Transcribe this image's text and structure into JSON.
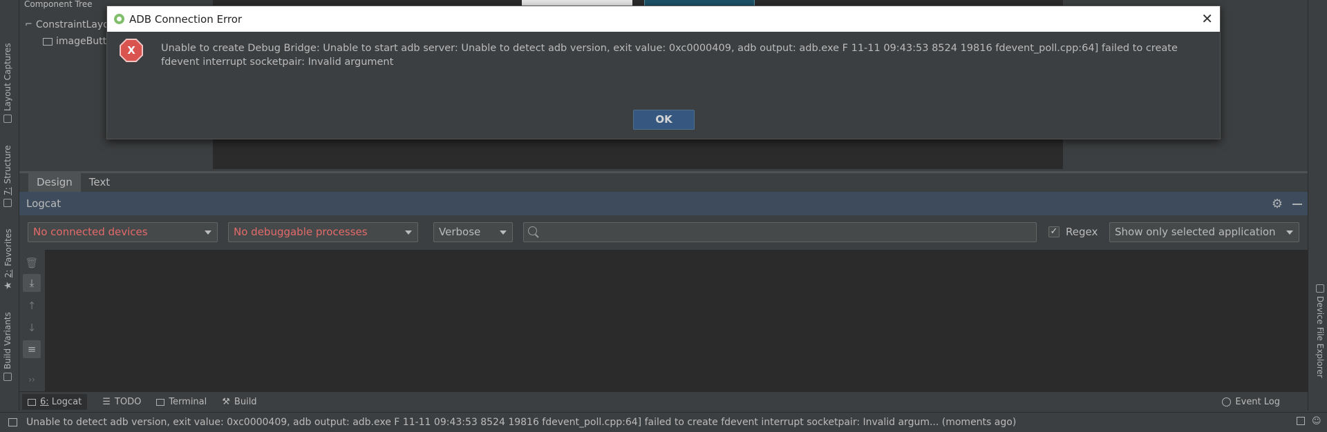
{
  "left_strip": {
    "tabs": [
      {
        "label": "Layout Captures",
        "icon": "camera-icon"
      },
      {
        "label": "Structure",
        "number": "7:"
      },
      {
        "label": "Favorites",
        "number": "2:"
      },
      {
        "label": "Build Variants"
      }
    ]
  },
  "right_strip": {
    "tabs": [
      {
        "label": "Device File Explorer",
        "icon": "device-icon"
      }
    ]
  },
  "component_tree": {
    "header": "Component Tree",
    "items": [
      "ConstraintLayo",
      "imageButt"
    ]
  },
  "editor_tabs": [
    "Design",
    "Text"
  ],
  "logcat": {
    "title": "Logcat",
    "device_select": "No connected devices",
    "process_select": "No debuggable processes",
    "level_select": "Verbose",
    "search_value": "",
    "search_placeholder": "",
    "regex_label": "Regex",
    "regex_checked": true,
    "filter_select": "Show only selected application"
  },
  "bottom_tabs": [
    {
      "label": "Logcat",
      "number": "6:",
      "active": true
    },
    {
      "label": "TODO"
    },
    {
      "label": "Terminal"
    },
    {
      "label": "Build"
    }
  ],
  "event_log": "Event Log",
  "status_bar": {
    "message": "Unable to detect adb version, exit value: 0xc0000409, adb output: adb.exe F 11-11 09:43:53  8524 19816 fdevent_poll.cpp:64] failed to create fdevent interrupt socketpair: Invalid argum... (moments ago)"
  },
  "dialog": {
    "title": "ADB Connection Error",
    "message": "Unable to create Debug Bridge: Unable to start adb server: Unable to detect adb version, exit value: 0xc0000409, adb output: adb.exe F 11-11 09:43:53  8524 19816 fdevent_poll.cpp:64] failed to create fdevent interrupt socketpair: Invalid argument",
    "ok_label": "OK",
    "error_glyph": "X"
  },
  "colors": {
    "background": "#3c3f41",
    "editor_bg": "#2b2b2b",
    "logcat_header": "#3d4b5c",
    "error_text": "#e46a6a",
    "ok_button": "#365880"
  }
}
